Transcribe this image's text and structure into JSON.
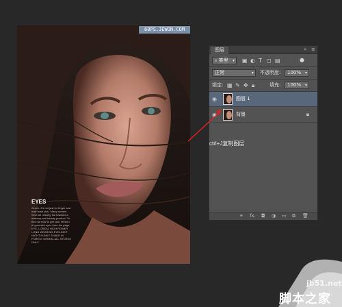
{
  "canvas": {
    "watermark": "68PS.JEWON.COM",
    "eyes_heading": "EYES",
    "eyes_text": "Green. It's not just for finger and mail bush pick. Many women have an unsung foe towards a makeup and beauty product. To find out how to get your version of greenish eyes from the page. EYE, LOREAL HIGH POWER LONG WEARING EYELINER NIGHT FUNKY SHADE IN FOREST GREEN, ALL STORES ONLY."
  },
  "layers_panel": {
    "tab": "图层",
    "head_icons": [
      "collapse-icon",
      "panel-menu-icon"
    ],
    "filter": {
      "value": "类型",
      "icons": [
        "image-filter-icon",
        "adjustment-filter-icon",
        "type-filter-icon",
        "shape-filter-icon",
        "smart-object-filter-icon",
        "filter-toggle-icon"
      ]
    },
    "blend": {
      "value": "正常",
      "opacity_label": "不透明度:",
      "opacity_value": "100%"
    },
    "lock": {
      "label": "锁定:",
      "fill_label": "填充:",
      "fill_value": "100%"
    },
    "layers": [
      {
        "name": "图层 1",
        "selected": true
      },
      {
        "name": "背景",
        "selected": false,
        "locked": true
      }
    ],
    "footer_icons": [
      "link-icon",
      "fx-icon",
      "mask-icon",
      "adjustment-icon",
      "folder-icon",
      "new-layer-icon",
      "trash-icon"
    ],
    "footer_fx": "fx."
  },
  "annotation": {
    "text": "ctrl+J复制图层",
    "arrow_color": "#e02020"
  },
  "site": {
    "url": "jb51.net",
    "name": "脚本之家"
  }
}
